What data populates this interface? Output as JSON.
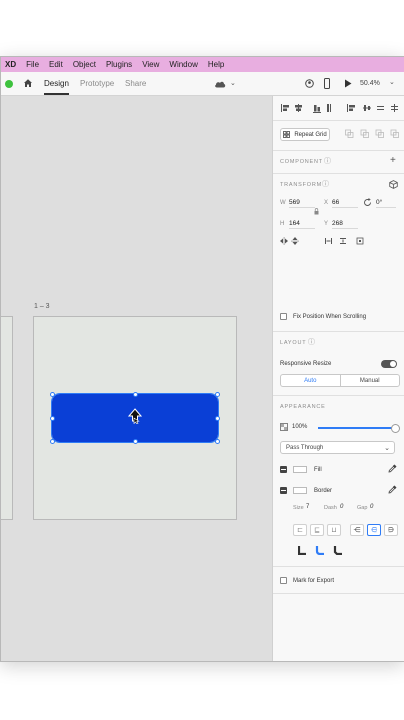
{
  "menubar": {
    "items": [
      "XD",
      "File",
      "Edit",
      "Object",
      "Plugins",
      "View",
      "Window",
      "Help"
    ]
  },
  "toolbar": {
    "tabs": [
      "Design",
      "Prototype",
      "Share"
    ],
    "active_tab": "Design",
    "zoom": "50.4%"
  },
  "canvas": {
    "artboard_label": "1 – 3",
    "shape_color": "#0a3fd6"
  },
  "panel": {
    "repeat_grid_label": "Repeat Grid",
    "component_title": "COMPONENT",
    "transform_title": "TRANSFORM",
    "w_label": "W",
    "w_value": "569",
    "x_label": "X",
    "x_value": "66",
    "rotation_value": "0°",
    "h_label": "H",
    "h_value": "164",
    "y_label": "Y",
    "y_value": "268",
    "fix_position_label": "Fix Position When Scrolling",
    "layout_title": "LAYOUT",
    "responsive_resize_label": "Responsive Resize",
    "seg_auto": "Auto",
    "seg_manual": "Manual",
    "appearance_title": "APPEARANCE",
    "opacity_value": "100%",
    "blend_mode": "Pass Through",
    "fill_label": "Fill",
    "border_label": "Border",
    "size_label": "Size",
    "size_value": "7",
    "dash_label": "Dash",
    "dash_value": "0",
    "gap_label": "Gap",
    "gap_value": "0",
    "mark_export_label": "Mark for Export"
  },
  "colors": {
    "menubar_bg": "#e8aee0",
    "accent": "#2f7cf6",
    "traffic_dot": "#3ec23e"
  },
  "icons": [
    "home-icon",
    "cloud-icon",
    "chevron-down-icon",
    "user-icon",
    "mobile-preview-icon",
    "play-icon",
    "align-icons",
    "repeat-grid-icon",
    "info-icon",
    "plus-icon",
    "3d-box-icon",
    "lock-icon",
    "rotate-icon",
    "flip-icon",
    "eyedropper-icon",
    "opacity-icon",
    "cursor-arrow-icon"
  ]
}
